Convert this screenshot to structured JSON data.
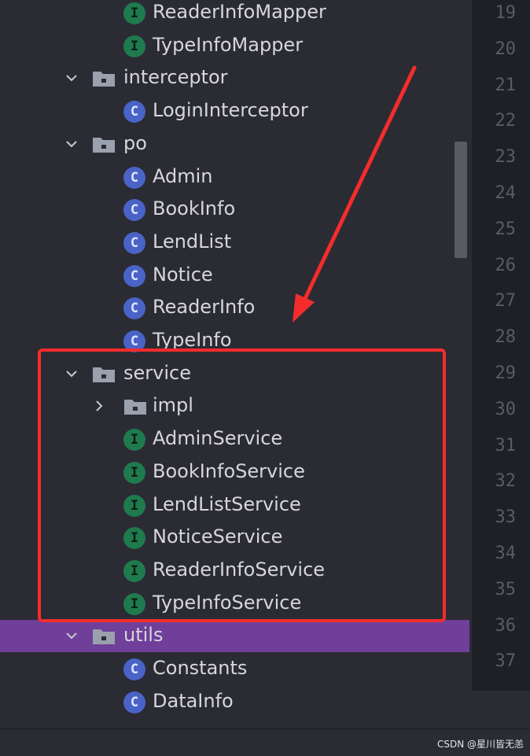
{
  "tree": {
    "rows": [
      {
        "label": "ReaderInfoMapper",
        "kind": "interface",
        "depth": 2,
        "expanded": null
      },
      {
        "label": "TypeInfoMapper",
        "kind": "interface",
        "depth": 2,
        "expanded": null
      },
      {
        "label": "interceptor",
        "kind": "package",
        "depth": 1,
        "expanded": true
      },
      {
        "label": "LoginInterceptor",
        "kind": "class",
        "depth": 2,
        "expanded": null
      },
      {
        "label": "po",
        "kind": "package",
        "depth": 1,
        "expanded": true
      },
      {
        "label": "Admin",
        "kind": "class",
        "depth": 2,
        "expanded": null
      },
      {
        "label": "BookInfo",
        "kind": "class",
        "depth": 2,
        "expanded": null
      },
      {
        "label": "LendList",
        "kind": "class",
        "depth": 2,
        "expanded": null
      },
      {
        "label": "Notice",
        "kind": "class",
        "depth": 2,
        "expanded": null
      },
      {
        "label": "ReaderInfo",
        "kind": "class",
        "depth": 2,
        "expanded": null
      },
      {
        "label": "TypeInfo",
        "kind": "class",
        "depth": 2,
        "expanded": null
      },
      {
        "label": "service",
        "kind": "package",
        "depth": 1,
        "expanded": true
      },
      {
        "label": "impl",
        "kind": "package",
        "depth": 2,
        "expanded": false
      },
      {
        "label": "AdminService",
        "kind": "interface",
        "depth": 2,
        "expanded": null
      },
      {
        "label": "BookInfoService",
        "kind": "interface",
        "depth": 2,
        "expanded": null
      },
      {
        "label": "LendListService",
        "kind": "interface",
        "depth": 2,
        "expanded": null
      },
      {
        "label": "NoticeService",
        "kind": "interface",
        "depth": 2,
        "expanded": null
      },
      {
        "label": "ReaderInfoService",
        "kind": "interface",
        "depth": 2,
        "expanded": null
      },
      {
        "label": "TypeInfoService",
        "kind": "interface",
        "depth": 2,
        "expanded": null
      },
      {
        "label": "utils",
        "kind": "package",
        "depth": 1,
        "expanded": true,
        "selected": true
      },
      {
        "label": "Constants",
        "kind": "class",
        "depth": 2,
        "expanded": null
      },
      {
        "label": "DataInfo",
        "kind": "class",
        "depth": 2,
        "expanded": null
      }
    ]
  },
  "gutter": {
    "line_numbers": [
      "19",
      "20",
      "21",
      "22",
      "23",
      "24",
      "25",
      "26",
      "27",
      "28",
      "29",
      "30",
      "31",
      "32",
      "33",
      "34",
      "35",
      "36",
      "37"
    ]
  },
  "icons": {
    "interface_badge": "I",
    "class_badge": "C",
    "package_icon": "folder-package-icon",
    "expanded_chevron": "chevron-down-icon",
    "collapsed_chevron": "chevron-right-icon"
  },
  "colors": {
    "background": "#2b2b34",
    "gutter": "#1f1f26",
    "selection": "#6f3f9a",
    "interface": "#1f7a4d",
    "class": "#4a63c6",
    "annotation": "#f42c2c"
  },
  "watermark": "CSDN @星川皆无恙"
}
